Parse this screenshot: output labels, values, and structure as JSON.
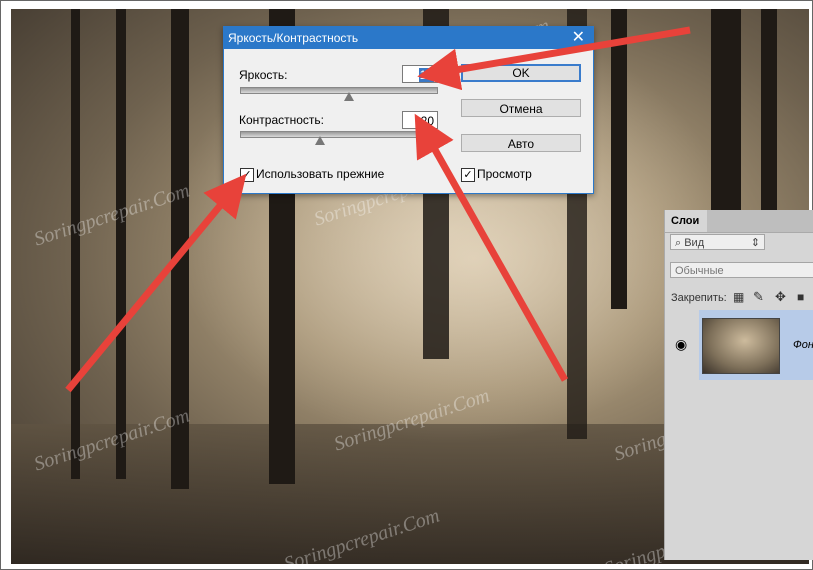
{
  "dialog": {
    "title": "Яркость/Контрастность",
    "brightness_label": "Яркость:",
    "brightness_value": "10",
    "contrast_label": "Контрастность:",
    "contrast_value": "-20",
    "use_legacy_label": "Использовать прежние",
    "preview_label": "Просмотр",
    "ok_label": "OK",
    "cancel_label": "Отмена",
    "auto_label": "Авто",
    "close_label": "✕",
    "check_mark": "✓"
  },
  "layers_panel": {
    "tab_label": "Слои",
    "search_label": "Вид",
    "blend_mode": "Обычные",
    "lock_label": "Закрепить:",
    "layer_name": "Фон"
  },
  "watermark": "Soringpcrepair.Com",
  "colors": {
    "dialog_titlebar": "#2b78c9",
    "annotation_arrow": "#e8423a",
    "selected_layer": "#b7cbe8"
  }
}
